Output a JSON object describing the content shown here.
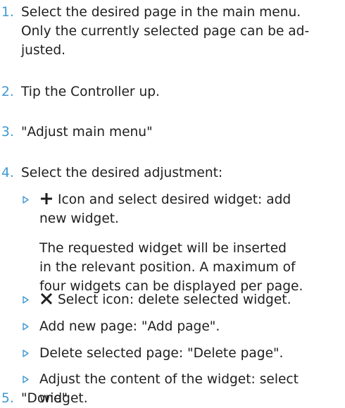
{
  "accent_color": "#3f98d2",
  "steps": [
    {
      "num": "1.",
      "lines": [
        "Select the desired page in the main menu.",
        "Only the currently selected page can be ad-",
        "justed."
      ]
    },
    {
      "num": "2.",
      "lines": [
        "Tip the Controller up."
      ]
    },
    {
      "num": "3.",
      "lines": [
        "\"Adjust main menu\""
      ]
    },
    {
      "num": "4.",
      "lines": [
        "Select the desired adjustment:"
      ]
    },
    {
      "num": "5.",
      "lines": [
        "\"Done\""
      ]
    }
  ],
  "options": [
    {
      "icon": "plus-icon",
      "lines": [
        "Icon and select desired widget: add",
        "new widget."
      ]
    },
    {
      "lines": [
        "The requested widget will be inserted",
        "in the relevant position. A maximum of",
        "four widgets can be displayed per page."
      ]
    },
    {
      "icon": "close-icon",
      "lines": [
        "Select icon: delete selected widget."
      ]
    },
    {
      "lines": [
        "Add new page: \"Add page\"."
      ]
    },
    {
      "lines": [
        "Delete selected page: \"Delete page\"."
      ]
    },
    {
      "lines": [
        "Adjust the content of the widget: select",
        "widget."
      ]
    }
  ]
}
